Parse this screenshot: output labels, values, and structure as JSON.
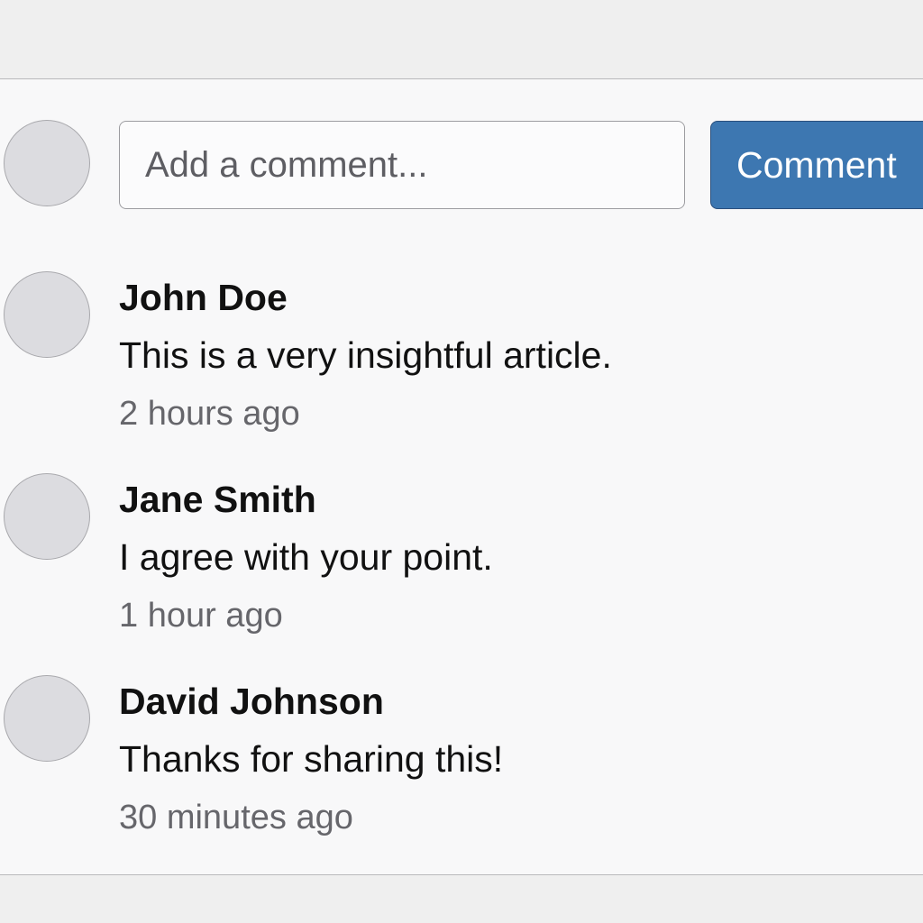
{
  "composer": {
    "placeholder": "Add a comment...",
    "button_label": "Comment"
  },
  "comments": [
    {
      "author": "John Doe",
      "text": "This is a very insightful article.",
      "time": "2 hours ago"
    },
    {
      "author": "Jane Smith",
      "text": "I agree with your point.",
      "time": "1 hour ago"
    },
    {
      "author": "David Johnson",
      "text": "Thanks for sharing this!",
      "time": "30 minutes ago"
    }
  ],
  "colors": {
    "accent": "#3d77b1",
    "avatar": "#dcdce0",
    "muted_text": "#66666b"
  }
}
